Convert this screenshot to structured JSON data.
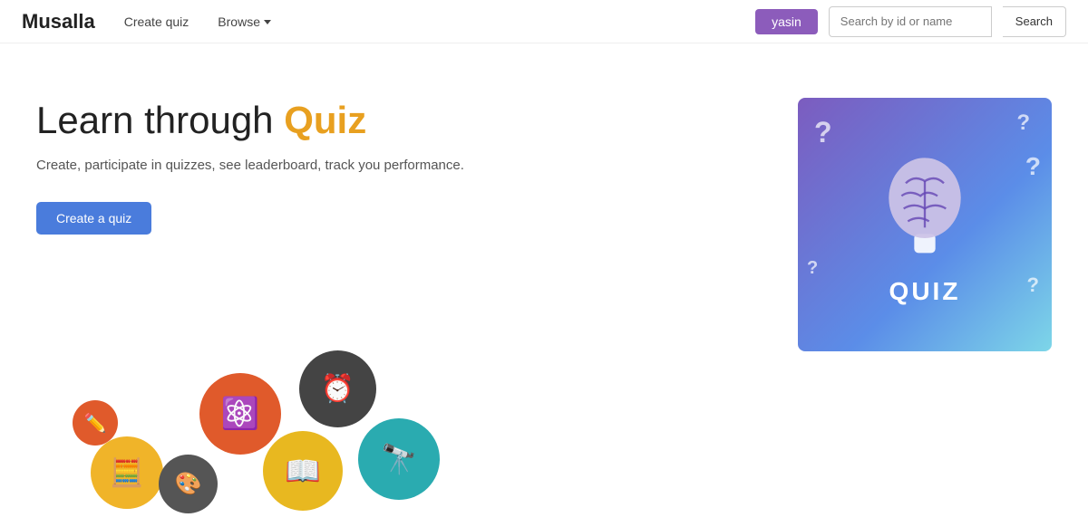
{
  "nav": {
    "logo": "Musalla",
    "create_quiz_label": "Create quiz",
    "browse_label": "Browse",
    "user_label": "yasin",
    "search_placeholder": "Search by id or name",
    "search_btn_label": "Search"
  },
  "hero": {
    "title_part1": "Learn through ",
    "title_highlight": "Quiz",
    "subtitle": "Create, participate in quizzes, see leaderboard, track you performance.",
    "create_btn_label": "Create a quiz",
    "quiz_image_label": "QUIZ"
  }
}
